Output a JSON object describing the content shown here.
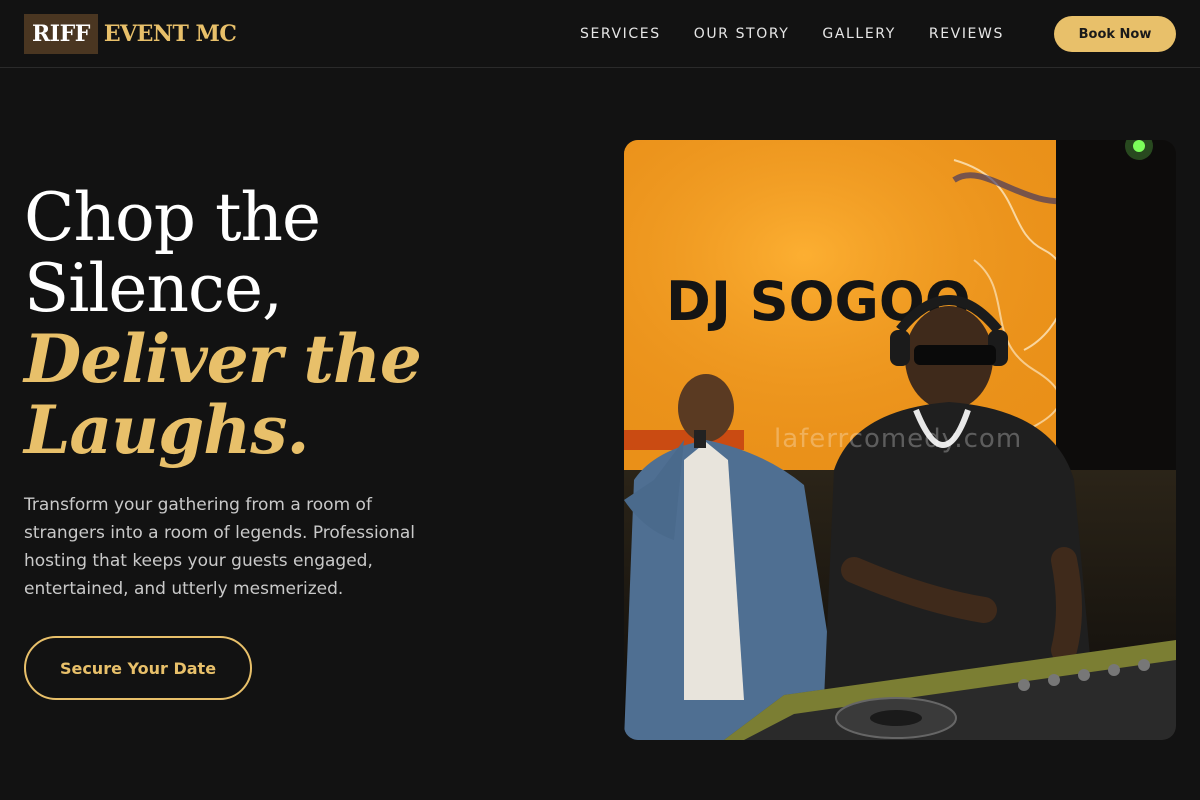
{
  "brand": {
    "logo_box": "RIFF",
    "logo_text": "EVENT MC"
  },
  "nav": {
    "items": [
      {
        "label": "SERVICES"
      },
      {
        "label": "OUR STORY"
      },
      {
        "label": "GALLERY"
      },
      {
        "label": "REVIEWS"
      }
    ],
    "cta_label": "Book Now"
  },
  "hero": {
    "title_lines": [
      "Chop the",
      "Silence,"
    ],
    "accent_lines": [
      "Deliver the",
      "Laughs."
    ],
    "description": "Transform your gathering from a room of strangers into a room of legends. Professional hosting that keeps your guests engaged, entertained, and utterly mesmerized.",
    "cta_label": "Secure Your Date",
    "image": {
      "screen_text": "DJ SOGOO",
      "watermark": "laferrcomedy.com"
    }
  },
  "colors": {
    "background": "#121212",
    "accent": "#e8c06a",
    "logo_box": "#4a3621",
    "text": "#ffffff",
    "muted_text": "#c9c9c9"
  }
}
